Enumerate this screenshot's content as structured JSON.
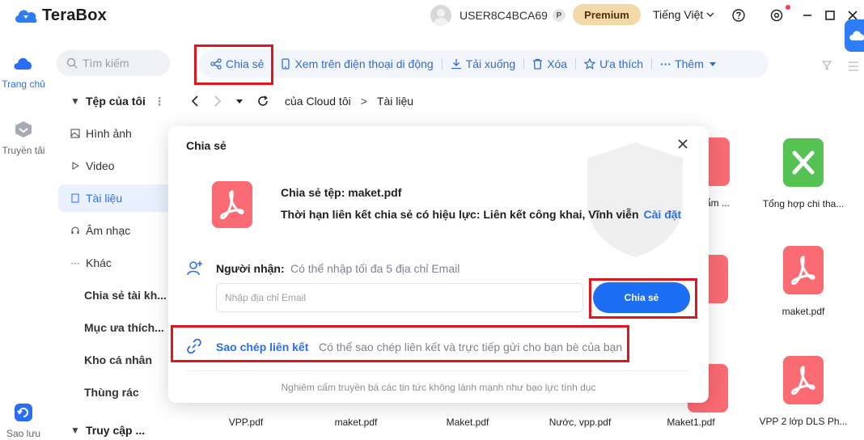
{
  "app": {
    "name": "TeraBox"
  },
  "header": {
    "username": "USER8C4BCA69",
    "badge": "P",
    "premium_label": "Premium",
    "language": "Tiếng Việt"
  },
  "rail": {
    "home": "Trang chủ",
    "transfer": "Truyền tải",
    "backup": "Sao lưu"
  },
  "sidebar": {
    "search_placeholder": "Tìm kiếm",
    "items": [
      {
        "label": "Tệp của tôi",
        "icon": "caret-down"
      },
      {
        "label": "Hình ảnh",
        "icon": "image"
      },
      {
        "label": "Video",
        "icon": "play"
      },
      {
        "label": "Tài liệu",
        "icon": "document"
      },
      {
        "label": "Âm nhạc",
        "icon": "headphones"
      },
      {
        "label": "Khác",
        "icon": "more"
      },
      {
        "label": "Chia sẻ tài kh..."
      },
      {
        "label": "Mục ưa thích..."
      },
      {
        "label": "Kho cá nhân"
      },
      {
        "label": "Thùng rác"
      },
      {
        "label": "Truy cập ..."
      }
    ]
  },
  "toolbar": {
    "share": "Chia sẻ",
    "view_mobile": "Xem trên điện thoại di động",
    "download": "Tải xuống",
    "delete": "Xóa",
    "favorite": "Ưa thích",
    "more": "Thêm"
  },
  "breadcrumb": {
    "root": "của Cloud tôi",
    "separator": ">",
    "current": "Tài liệu"
  },
  "files": [
    {
      "name": "VPP.pdf",
      "type": "pdf"
    },
    {
      "name": "maket.pdf",
      "type": "pdf"
    },
    {
      "name": "Maket.pdf",
      "type": "pdf"
    },
    {
      "name": "Nước, vpp.pdf",
      "type": "pdf"
    },
    {
      "name": "Maket1.pdf",
      "type": "pdf"
    },
    {
      "name": "VPP 2 lớp DLS Ph...",
      "type": "pdf"
    },
    {
      "name": "Tổng hợp chi tha...",
      "type": "xlsx"
    },
    {
      "name": "maket.pdf",
      "type": "pdf"
    },
    {
      "name": "ẩm ...",
      "type": "pdf"
    }
  ],
  "dialog": {
    "title": "Chia sẻ",
    "file_line": "Chia sẻ tệp: maket.pdf",
    "validity_line": "Thời hạn liên kết chia sẻ có hiệu lực: Liên kết công khai, Vĩnh viễn",
    "settings_link": "Cài đặt",
    "recipient_label": "Người nhận:",
    "recipient_hint": "Có thể nhập tối đa 5 địa chỉ Email",
    "email_placeholder": "Nhập địa chỉ Email",
    "share_button": "Chia sẻ",
    "copy_link_label": "Sao chép liên kết",
    "copy_link_hint": "Có thể sao chép liên kết và trực tiếp gửi cho bạn bè của bạn",
    "footer_notice": "Nghiêm cấm truyền bá các tin tức không lành mạnh như bạo lực tình dục"
  },
  "colors": {
    "accent": "#2a6ef5",
    "pdf": "#fa6b73",
    "xlsx": "#56c254",
    "premium": "#f4d9a8",
    "highlight": "#e0161f"
  }
}
